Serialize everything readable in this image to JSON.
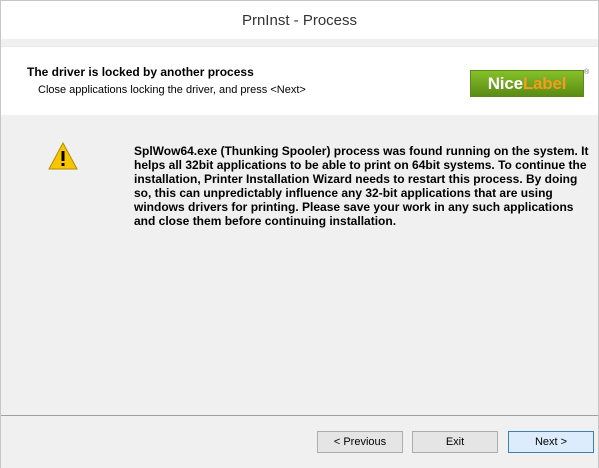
{
  "window": {
    "title": "PrnInst - Process"
  },
  "header": {
    "title": "The driver is locked by another process",
    "subtitle": "Close applications locking the driver, and press <Next>",
    "logo": {
      "part1": "Nice",
      "part2": "Label",
      "mark": "®"
    }
  },
  "content": {
    "icon": "warning-icon",
    "message": "SplWow64.exe (Thunking Spooler) process was found running on the system. It helps all 32bit applications to be able to print on 64bit systems. To continue the installation, Printer Installation Wizard needs to restart this process. By doing so, this can unpredictably influence any 32-bit applications that are using windows drivers for printing. Please save your work in any such applications and close them before continuing installation."
  },
  "buttons": {
    "previous": "< Previous",
    "exit": "Exit",
    "next": "Next >"
  },
  "colors": {
    "logo_green": "#6fa21f",
    "logo_orange": "#f39c1e",
    "warning_yellow": "#f7c600"
  }
}
